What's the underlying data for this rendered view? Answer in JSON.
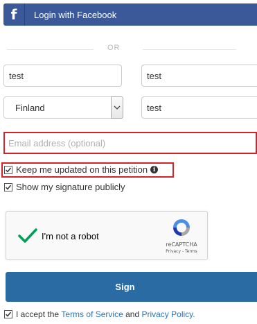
{
  "facebook": {
    "icon": "facebook-f-icon",
    "label": "Login with Facebook",
    "color": "#3b5998"
  },
  "divider": {
    "text": "OR"
  },
  "form": {
    "first_name": "test",
    "last_name": "test",
    "country": "Finland",
    "postal": "test",
    "email_placeholder": "Email address (optional)",
    "email_value": ""
  },
  "checkboxes": {
    "keep_updated": {
      "label": "Keep me updated on this petition",
      "checked": true
    },
    "show_signature": {
      "label": "Show my signature publicly",
      "checked": true
    },
    "accept": {
      "checked": true,
      "prefix": "I accept the",
      "terms_link": "Terms of Service",
      "and": "and",
      "privacy_link": "Privacy Policy."
    }
  },
  "recaptcha": {
    "label": "I'm not a robot",
    "brand": "reCAPTCHA",
    "privacy": "Privacy",
    "sep": " - ",
    "terms": "Terms",
    "check_color": "#009e55"
  },
  "sign": {
    "label": "Sign",
    "color": "#2a6ba3"
  },
  "highlight_color": "#d2232a"
}
